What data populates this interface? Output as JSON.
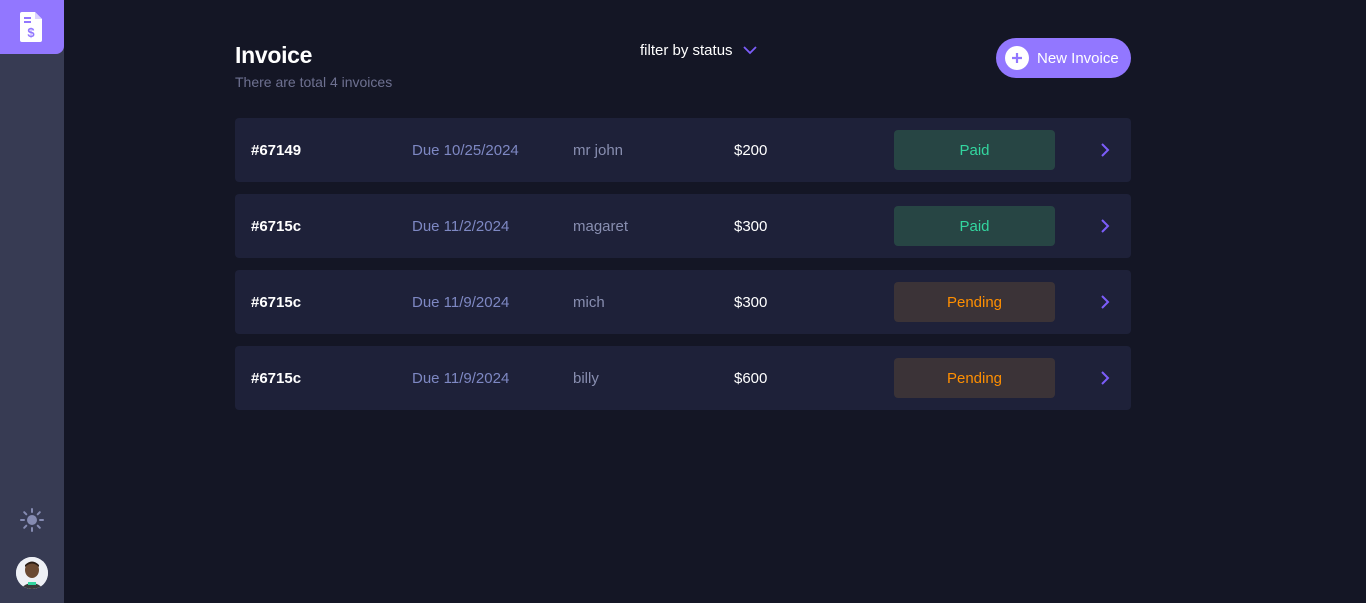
{
  "header": {
    "title": "Invoice",
    "subtitle": "There are total 4 invoices",
    "filter_label": "filter by status",
    "new_button_label": "New Invoice"
  },
  "invoices": [
    {
      "id": "#67149",
      "due": "Due 10/25/2024",
      "client": "mr john",
      "amount": "$200",
      "status": "Paid"
    },
    {
      "id": "#6715c",
      "due": "Due 11/2/2024",
      "client": "magaret",
      "amount": "$300",
      "status": "Paid"
    },
    {
      "id": "#6715c",
      "due": "Due 11/9/2024",
      "client": "mich",
      "amount": "$300",
      "status": "Pending"
    },
    {
      "id": "#6715c",
      "due": "Due 11/9/2024",
      "client": "billy",
      "amount": "$600",
      "status": "Pending"
    }
  ],
  "icons": {
    "logo": "invoice-document-icon",
    "theme": "sun-icon",
    "filter": "chevron-down-icon",
    "new": "plus-icon",
    "row": "chevron-right-icon"
  },
  "colors": {
    "accent": "#9277ff",
    "background": "#141625",
    "sidebar": "#373b53",
    "row": "#1e2139",
    "paid": "#33d69f",
    "pending": "#ff8f00"
  }
}
